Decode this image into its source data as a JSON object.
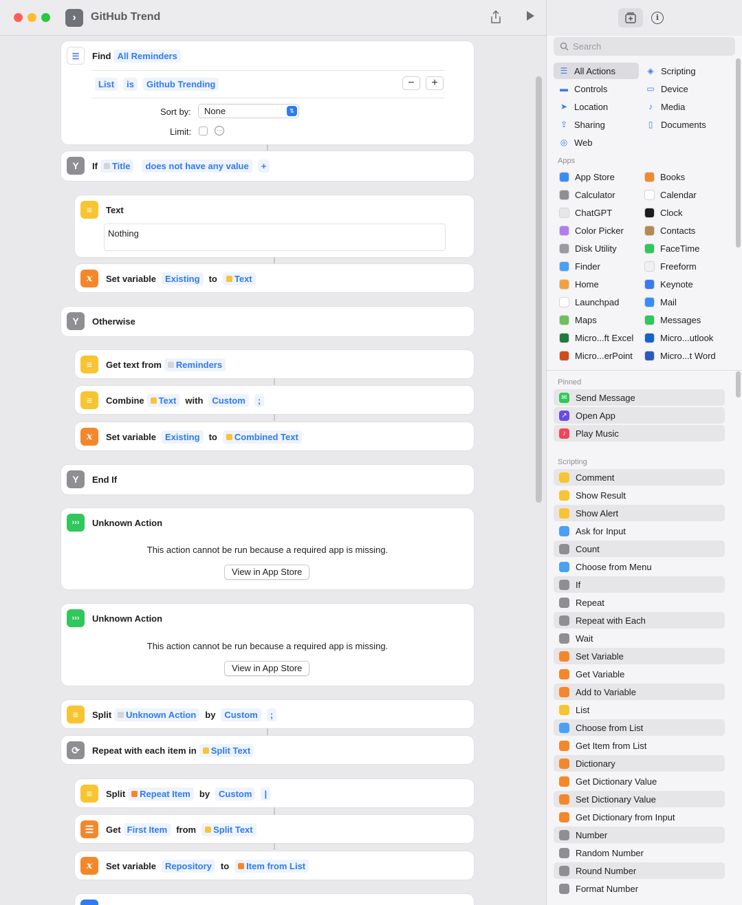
{
  "window": {
    "title": "GitHub Trend"
  },
  "find": {
    "verb": "Find",
    "source": "All Reminders",
    "filter_field": "List",
    "filter_op": "is",
    "filter_value": "Github Trending",
    "sort_label": "Sort by:",
    "sort_value": "None",
    "limit_label": "Limit:"
  },
  "if_block": {
    "label": "If",
    "variable": "Title",
    "condition": "does not have any value",
    "add": "+"
  },
  "text_action": {
    "label": "Text",
    "content": "Nothing"
  },
  "set_var1": {
    "label": "Set variable",
    "name": "Existing",
    "to": "to",
    "value": "Text"
  },
  "otherwise": {
    "label": "Otherwise"
  },
  "get_text": {
    "label": "Get text from",
    "value": "Reminders"
  },
  "combine": {
    "label": "Combine",
    "value": "Text",
    "with": "with",
    "mode": "Custom",
    "sep": ";"
  },
  "set_var2": {
    "label": "Set variable",
    "name": "Existing",
    "to": "to",
    "value": "Combined Text"
  },
  "end_if": {
    "label": "End If"
  },
  "unknown1": {
    "label": "Unknown Action",
    "message": "This action cannot be run because a required app is missing.",
    "button": "View in App Store"
  },
  "unknown2": {
    "label": "Unknown Action",
    "message": "This action cannot be run because a required app is missing.",
    "button": "View in App Store"
  },
  "split1": {
    "label": "Split",
    "value": "Unknown Action",
    "by": "by",
    "mode": "Custom",
    "sep": ";"
  },
  "repeat": {
    "label": "Repeat with each item in",
    "value": "Split Text"
  },
  "split2": {
    "label": "Split",
    "value": "Repeat Item",
    "by": "by",
    "mode": "Custom",
    "sep": "|"
  },
  "get_item": {
    "label": "Get",
    "value": "First Item",
    "from": "from",
    "source": "Split Text"
  },
  "set_var3": {
    "label": "Set variable",
    "name": "Repository",
    "to": "to",
    "value": "Item from List"
  },
  "sidebar": {
    "search_placeholder": "Search",
    "categories": [
      {
        "label": "All Actions",
        "icon": "list-icon"
      },
      {
        "label": "Scripting",
        "icon": "scripting-icon"
      },
      {
        "label": "Controls",
        "icon": "controls-icon"
      },
      {
        "label": "Device",
        "icon": "device-icon"
      },
      {
        "label": "Location",
        "icon": "location-icon"
      },
      {
        "label": "Media",
        "icon": "music-note-icon"
      },
      {
        "label": "Sharing",
        "icon": "share-icon"
      },
      {
        "label": "Documents",
        "icon": "document-icon"
      },
      {
        "label": "Web",
        "icon": "compass-icon"
      }
    ],
    "apps_header": "Apps",
    "apps": [
      "App Store",
      "Books",
      "Calculator",
      "Calendar",
      "ChatGPT",
      "Clock",
      "Color Picker",
      "Contacts",
      "Disk Utility",
      "FaceTime",
      "Finder",
      "Freeform",
      "Home",
      "Keynote",
      "Launchpad",
      "Mail",
      "Maps",
      "Messages",
      "Micro...ft Excel",
      "Micro...utlook",
      "Micro...erPoint",
      "Micro...t Word"
    ],
    "pinned_header": "Pinned",
    "pinned": [
      "Send Message",
      "Open App",
      "Play Music"
    ],
    "scripting_header": "Scripting",
    "scripting": [
      "Comment",
      "Show Result",
      "Show Alert",
      "Ask for Input",
      "Count",
      "Choose from Menu",
      "If",
      "Repeat",
      "Repeat with Each",
      "Wait",
      "Set Variable",
      "Get Variable",
      "Add to Variable",
      "List",
      "Choose from List",
      "Get Item from List",
      "Dictionary",
      "Get Dictionary Value",
      "Set Dictionary Value",
      "Get Dictionary from Input",
      "Number",
      "Random Number",
      "Round Number",
      "Format Number"
    ]
  }
}
